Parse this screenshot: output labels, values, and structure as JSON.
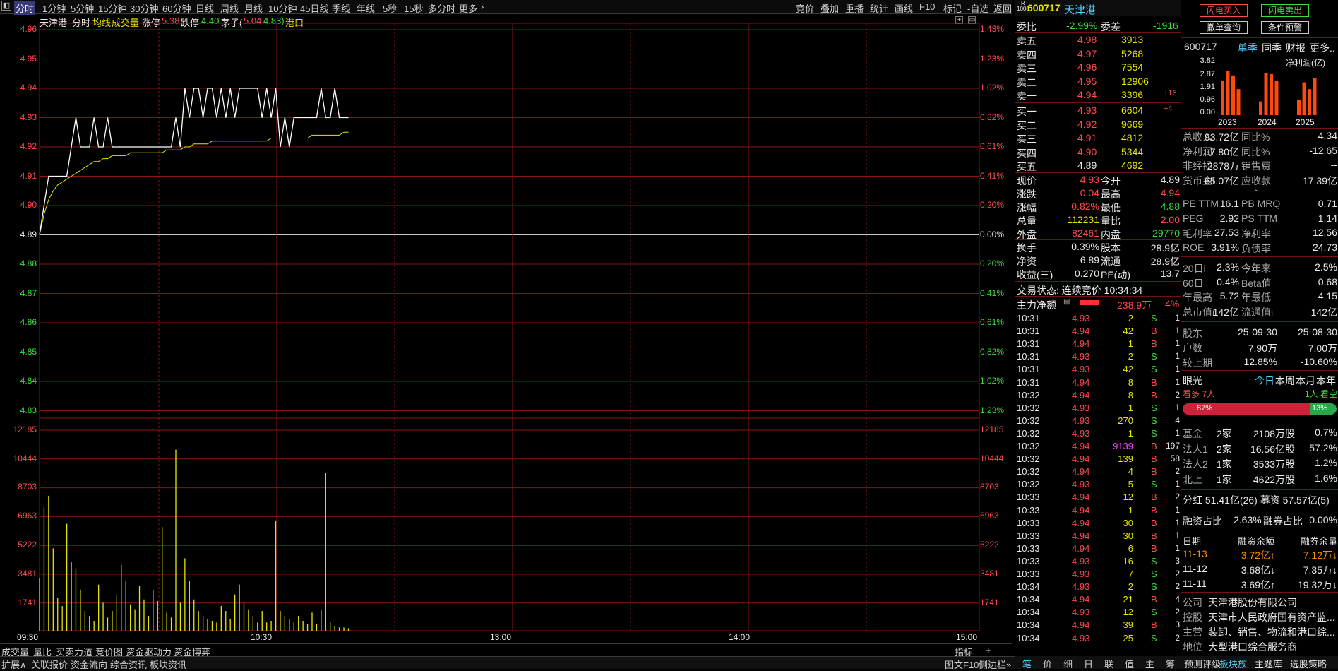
{
  "toolbar": {
    "timeframes": [
      "分时",
      "1分钟",
      "5分钟",
      "15分钟",
      "30分钟",
      "60分钟",
      "日线",
      "周线",
      "月线",
      "10分钟",
      "45日线",
      "季线",
      "年线",
      "5秒",
      "15秒",
      "多分时",
      "更多"
    ],
    "right_items": [
      "竞价",
      "叠加",
      "重播",
      "统计",
      "画线",
      "F10",
      "标记",
      "-自选",
      "返回"
    ]
  },
  "legend": {
    "name": "天津港",
    "mode": "分时",
    "avg": "均线",
    "volume": "成交量",
    "limit_up_label": "涨停",
    "limit_up": "5.38",
    "limit_down_label": "跌停",
    "limit_down": "4.40",
    "sub_label": "茅子(",
    "sub_val1": "5.04",
    "sub_val2": "4.83)",
    "port": "港口"
  },
  "axis_left": [
    "4.96",
    "4.95",
    "4.94",
    "4.93",
    "4.92",
    "4.91",
    "4.90",
    "4.89",
    "4.88",
    "4.87",
    "4.86",
    "4.85",
    "4.84",
    "4.83",
    "12185",
    "10444",
    "8703",
    "6963",
    "5222",
    "3481",
    "1741"
  ],
  "axis_right": [
    "1.43%",
    "1.23%",
    "1.02%",
    "0.82%",
    "0.61%",
    "0.41%",
    "0.20%",
    "0.00%",
    "0.20%",
    "0.41%",
    "0.61%",
    "0.82%",
    "1.02%",
    "1.23%",
    "12185",
    "10444",
    "8703",
    "6963",
    "5222",
    "3481",
    "1741"
  ],
  "time_labels": [
    "09:30",
    "10:30",
    "13:00",
    "14:00",
    "15:00"
  ],
  "bottom_tabs": [
    "成交量",
    "量比",
    "买卖力道",
    "竞价图",
    "资金驱动力",
    "资金博弈"
  ],
  "bottom_tools": [
    "指标",
    "+",
    "-"
  ],
  "bottom_bar": [
    "扩展∧",
    "关联报价",
    "资金流向",
    "综合资讯",
    "板块资讯"
  ],
  "bottom_bar_right": [
    "图文F10",
    "侧边栏»"
  ],
  "chart_data": {
    "type": "line",
    "title": "天津港 分时",
    "xlabel": "",
    "ylabel": "",
    "ylim": [
      4.83,
      4.96
    ],
    "price": [
      4.89,
      4.9,
      4.91,
      4.91,
      4.91,
      4.91,
      4.91,
      4.92,
      4.93,
      4.92,
      4.92,
      4.92,
      4.93,
      4.92,
      4.92,
      4.93,
      4.92,
      4.92,
      4.92,
      4.92,
      4.92,
      4.92,
      4.92,
      4.92,
      4.92,
      4.92,
      4.92,
      4.92,
      4.92,
      4.92,
      4.93,
      4.92,
      4.94,
      4.93,
      4.94,
      4.94,
      4.93,
      4.94,
      4.94,
      4.93,
      4.94,
      4.93,
      4.94,
      4.93,
      4.94,
      4.94,
      4.94,
      4.94,
      4.94,
      4.93,
      4.94,
      4.93,
      4.94,
      4.92,
      4.93,
      4.92,
      4.93,
      4.93,
      4.93,
      4.93,
      4.93,
      4.93,
      4.94,
      4.93,
      4.93,
      4.94,
      4.93,
      4.93,
      4.93
    ],
    "avg": [
      4.89,
      4.897,
      4.902,
      4.905,
      4.907,
      4.908,
      4.909,
      4.91,
      4.911,
      4.912,
      4.913,
      4.914,
      4.915,
      4.915,
      4.916,
      4.916,
      4.917,
      4.917,
      4.917,
      4.917,
      4.918,
      4.918,
      4.918,
      4.918,
      4.918,
      4.918,
      4.918,
      4.918,
      4.919,
      4.919,
      4.919,
      4.919,
      4.92,
      4.92,
      4.921,
      4.921,
      4.921,
      4.921,
      4.922,
      4.922,
      4.922,
      4.922,
      4.922,
      4.922,
      4.922,
      4.922,
      4.922,
      4.922,
      4.922,
      4.922,
      4.922,
      4.923,
      4.923,
      4.923,
      4.923,
      4.923,
      4.923,
      4.923,
      4.923,
      4.923,
      4.924,
      4.924,
      4.924,
      4.924,
      4.924,
      4.924,
      4.924,
      4.925,
      4.925
    ],
    "volume": [
      3200,
      7500,
      8200,
      5000,
      2000,
      1500,
      6500,
      4200,
      3800,
      2500,
      1200,
      900,
      600,
      2800,
      1700,
      800,
      1200,
      2200,
      4000,
      3000,
      1600,
      1300,
      2700,
      1900,
      900,
      2500,
      1800,
      6300,
      1100,
      800,
      11000,
      1700,
      4400,
      3000,
      1900,
      1200,
      900,
      700,
      600,
      500,
      1500,
      1200,
      700,
      2200,
      2800,
      1700,
      1300,
      900,
      500,
      1200,
      500,
      600,
      6700,
      1200,
      900,
      700,
      500,
      900,
      600,
      400,
      1100,
      400,
      1300,
      9600,
      500,
      300,
      200,
      200,
      150
    ]
  },
  "quote": {
    "code": "600717",
    "name": "天津港",
    "weibi_label": "委比",
    "weibi": "-2.99%",
    "weicha_label": "委差",
    "weicha": "-1916",
    "sells": [
      {
        "l": "卖五",
        "p": "4.98",
        "v": "3913",
        "x": ""
      },
      {
        "l": "卖四",
        "p": "4.97",
        "v": "5268",
        "x": ""
      },
      {
        "l": "卖三",
        "p": "4.96",
        "v": "7554",
        "x": ""
      },
      {
        "l": "卖二",
        "p": "4.95",
        "v": "12906",
        "x": ""
      },
      {
        "l": "卖一",
        "p": "4.94",
        "v": "3396",
        "x": "+16"
      }
    ],
    "buys": [
      {
        "l": "买一",
        "p": "4.93",
        "v": "6604",
        "x": "+4"
      },
      {
        "l": "买二",
        "p": "4.92",
        "v": "9669",
        "x": ""
      },
      {
        "l": "买三",
        "p": "4.91",
        "v": "4812",
        "x": ""
      },
      {
        "l": "买四",
        "p": "4.90",
        "v": "5344",
        "x": ""
      },
      {
        "l": "买五",
        "p": "4.89",
        "v": "4692",
        "x": ""
      }
    ],
    "stats": [
      [
        "现价",
        "4.93",
        "今开",
        "4.89"
      ],
      [
        "涨跌",
        "0.04",
        "最高",
        "4.94"
      ],
      [
        "涨幅",
        "0.82%",
        "最低",
        "4.88"
      ],
      [
        "总量",
        "112231",
        "量比",
        "2.00"
      ],
      [
        "外盘",
        "82461",
        "内盘",
        "29770"
      ]
    ],
    "stats2": [
      [
        "换手",
        "0.39%",
        "股本",
        "28.9亿"
      ],
      [
        "净资",
        "6.89",
        "流通",
        "28.9亿"
      ],
      [
        "收益(三)",
        "0.270",
        "PE(动)",
        "13.7"
      ]
    ],
    "status": "交易状态: 连续竞价 10:34:34",
    "main_flow_label": "主力净额",
    "main_flow": "238.9万",
    "main_pct": "4%"
  },
  "ticks": [
    [
      "10:31",
      "4.93",
      "2",
      "S",
      "1"
    ],
    [
      "10:31",
      "4.94",
      "42",
      "B",
      "1"
    ],
    [
      "10:31",
      "4.94",
      "1",
      "B",
      "1"
    ],
    [
      "10:31",
      "4.93",
      "2",
      "S",
      "1"
    ],
    [
      "10:31",
      "4.93",
      "42",
      "S",
      "1"
    ],
    [
      "10:31",
      "4.94",
      "8",
      "B",
      "1"
    ],
    [
      "10:32",
      "4.94",
      "8",
      "B",
      "2"
    ],
    [
      "10:32",
      "4.93",
      "1",
      "S",
      "1"
    ],
    [
      "10:32",
      "4.93",
      "270",
      "S",
      "4"
    ],
    [
      "10:32",
      "4.93",
      "1",
      "S",
      "1"
    ],
    [
      "10:32",
      "4.94",
      "9139",
      "B",
      "197"
    ],
    [
      "10:32",
      "4.94",
      "139",
      "B",
      "58"
    ],
    [
      "10:32",
      "4.94",
      "4",
      "B",
      "2"
    ],
    [
      "10:32",
      "4.93",
      "5",
      "S",
      "1"
    ],
    [
      "10:33",
      "4.94",
      "12",
      "B",
      "2"
    ],
    [
      "10:33",
      "4.94",
      "1",
      "B",
      "1"
    ],
    [
      "10:33",
      "4.94",
      "30",
      "B",
      "1"
    ],
    [
      "10:33",
      "4.94",
      "30",
      "B",
      "1"
    ],
    [
      "10:33",
      "4.94",
      "6",
      "B",
      "1"
    ],
    [
      "10:33",
      "4.93",
      "16",
      "S",
      "3"
    ],
    [
      "10:33",
      "4.93",
      "7",
      "S",
      "2"
    ],
    [
      "10:34",
      "4.93",
      "2",
      "S",
      "2"
    ],
    [
      "10:34",
      "4.94",
      "21",
      "B",
      "4"
    ],
    [
      "10:34",
      "4.93",
      "12",
      "S",
      "2"
    ],
    [
      "10:34",
      "4.94",
      "39",
      "B",
      "3"
    ],
    [
      "10:34",
      "4.93",
      "25",
      "S",
      "2"
    ]
  ],
  "side_tabs": [
    "笔",
    "价",
    "细",
    "日",
    "联",
    "值",
    "主",
    "筹"
  ],
  "right": {
    "flash_buy": "闪电买入",
    "flash_sell": "闪电卖出",
    "cancel": "撤单查询",
    "alert": "条件预警",
    "code": "600717",
    "tabs": [
      "单季",
      "同季",
      "财报",
      "更多.."
    ],
    "ylabel": "净利润(亿)",
    "yvals": [
      "3.82",
      "2.87",
      "1.91",
      "0.96",
      "0.00"
    ],
    "years": [
      "2023",
      "2024",
      "2025"
    ],
    "bars": [
      2.5,
      3.2,
      2.9,
      1.9,
      1.0,
      3.1,
      3.0,
      2.5,
      1.1,
      2.4,
      1.9,
      2.7
    ],
    "fin": [
      [
        "总收入",
        "93.72亿",
        "同比%",
        "4.34"
      ],
      [
        "净利润",
        "7.80亿",
        "同比%",
        "-12.65"
      ],
      [
        "非经损",
        "-2878万",
        "销售费",
        "--"
      ],
      [
        "货币金i",
        "65.07亿",
        "应收款",
        "17.39亿"
      ]
    ],
    "val": [
      [
        "PE TTM",
        "16.1",
        "PB MRQ",
        "0.71"
      ],
      [
        "PEG",
        "2.92",
        "PS TTM",
        "1.14"
      ],
      [
        "毛利率",
        "27.53",
        "净利率",
        "12.56"
      ],
      [
        "ROE",
        "3.91%",
        "负债率",
        "24.73"
      ]
    ],
    "perf": [
      [
        "20日i",
        "2.3%",
        "今年来",
        "2.5%"
      ],
      [
        "60日",
        "0.4%",
        "Beta值",
        "0.68"
      ],
      [
        "年最高",
        "5.72",
        "年最低",
        "4.15"
      ],
      [
        "总市值i",
        "142亿",
        "流通值i",
        "142亿"
      ]
    ],
    "holders": [
      [
        "股东",
        "25-09-30",
        "25-08-30"
      ],
      [
        "户数",
        "7.90万",
        "7.00万"
      ],
      [
        "较上期",
        "12.85%",
        "-10.60%"
      ]
    ],
    "eye": "眼光",
    "eye_tabs": [
      "今日",
      "本周",
      "本月",
      "本年"
    ],
    "bull": "看多 7人",
    "bear": "1人 看空",
    "bull_pct": "87%",
    "bear_pct": "13%",
    "inst": [
      [
        "基金",
        "2家",
        "2108万股",
        "0.7%"
      ],
      [
        "法人1",
        "2家",
        "16.56亿股",
        "57.2%"
      ],
      [
        "法人2",
        "1家",
        "3533万股",
        "1.2%"
      ],
      [
        "北上",
        "1家",
        "4622万股",
        "1.6%"
      ]
    ],
    "div": "分红  51.41亿(26) 募资  57.57亿(5)",
    "margin": [
      "融资占比",
      "2.63%",
      "融券占比",
      "0.00%"
    ],
    "mhead": [
      "日期",
      "融资余额",
      "融券余量"
    ],
    "mrows": [
      [
        "11-13",
        "3.72亿↑",
        "7.12万↓"
      ],
      [
        "11-12",
        "3.68亿↓",
        "7.35万↓"
      ],
      [
        "11-11",
        "3.69亿↑",
        "19.32万↓"
      ]
    ],
    "company": [
      [
        "公司",
        "天津港股份有限公司"
      ],
      [
        "控股",
        "天津市人民政府国有资产监..."
      ],
      [
        "主营",
        "装卸、销售、物流和港口综..."
      ],
      [
        "地位",
        "大型港口综合服务商"
      ]
    ],
    "bottom": [
      "预测评级",
      "板块族",
      "主题库",
      "选股策略"
    ]
  }
}
